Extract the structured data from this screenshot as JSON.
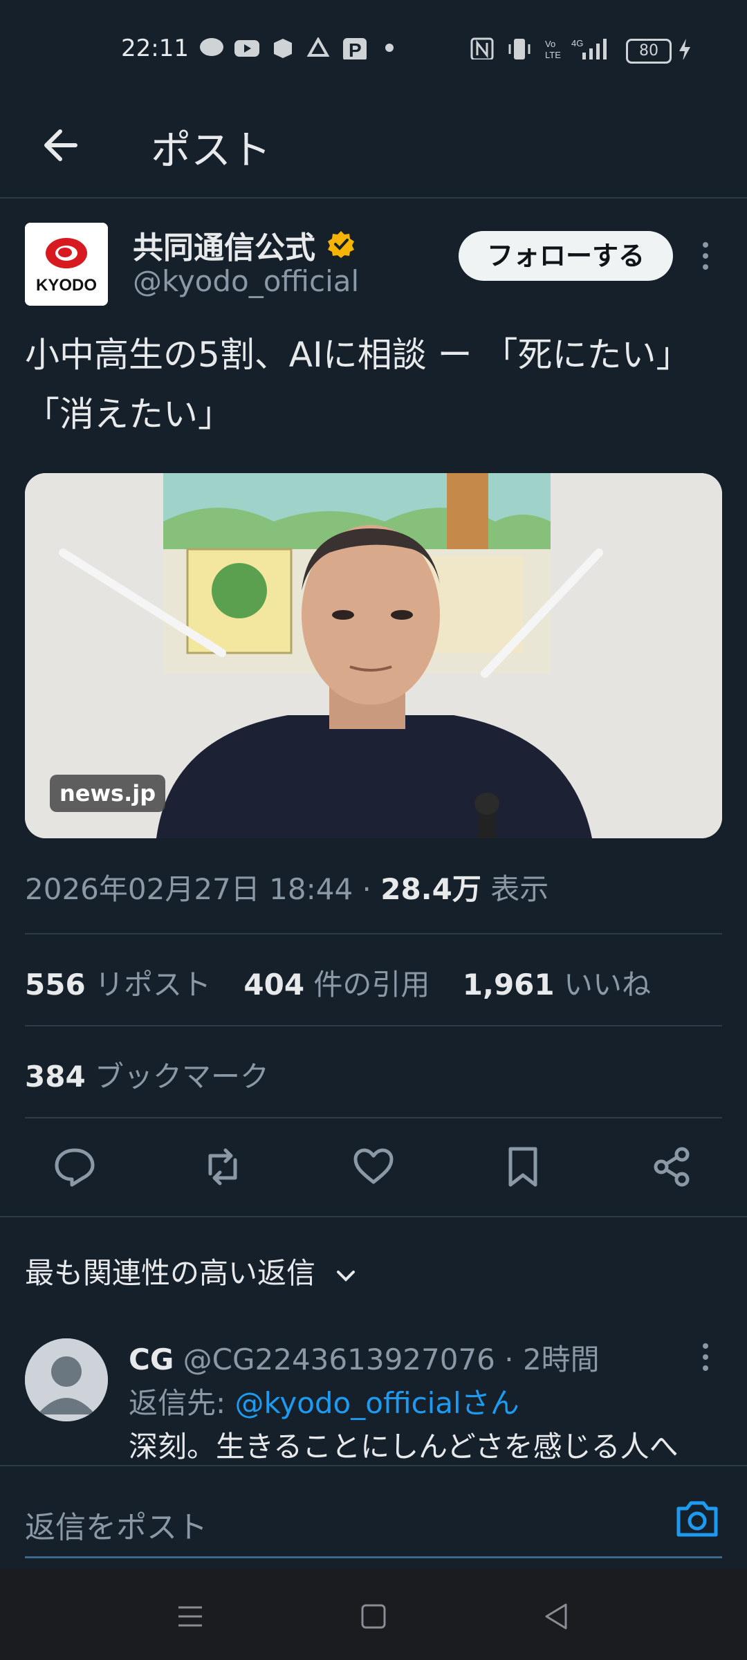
{
  "status_bar": {
    "time": "22:11",
    "battery": "80"
  },
  "header": {
    "title": "ポスト"
  },
  "post": {
    "author_name": "共同通信公式",
    "handle": "@kyodo_official",
    "follow_label": "フォローする",
    "logo_text": "KYODO",
    "text_line1": "小中高生の5割、AIに相談 ー 「死にたい」",
    "text_line2": "「消えたい」",
    "media_badge": "news.jp",
    "datetime": "2026年02月27日 18:44 · ",
    "views_count": "28.4万",
    "views_label": " 表示",
    "reposts_count": "556",
    "reposts_label": " リポスト",
    "quotes_count": "404",
    "quotes_label": " 件の引用",
    "likes_count": "1,961",
    "likes_label": " いいね",
    "bookmarks_count": "384",
    "bookmarks_label": " ブックマーク"
  },
  "replies": {
    "sort_label": "最も関連性の高い返信",
    "items": [
      {
        "name": "CG",
        "handle_time": " @CG2243613927076 · 2時間",
        "reply_to_prefix": "返信先: ",
        "reply_to_handle": "@kyodo_officialさん",
        "text": "深刻。生きることにしんどさを感じる人へ"
      }
    ]
  },
  "composer": {
    "placeholder": "返信をポスト"
  },
  "colors": {
    "background": "#15202b",
    "accent": "#1d9bf0",
    "muted": "#8b98a5",
    "verified": "#f4b400"
  }
}
